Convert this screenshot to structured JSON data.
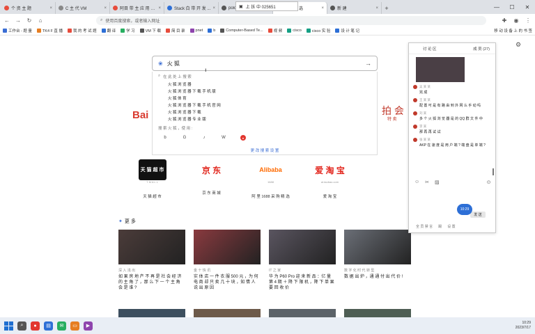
{
  "tabs": [
    {
      "label": "个 资 主 题",
      "color": "#e74c3c",
      "active": false
    },
    {
      "label": "C 主 代 VM",
      "color": "#888888",
      "active": false
    },
    {
      "label": "阿目 带 主 应 用 app 开 户 ...",
      "color": "#e74c3c",
      "active": false
    },
    {
      "label": "Stack 白 带 开 发 ...",
      "color": "#2d6fd6",
      "active": false
    },
    {
      "label": "pology",
      "color": "#555555",
      "active": false
    },
    {
      "label": "带 拍 选 选",
      "color": "#e74c3c",
      "active": true
    },
    {
      "label": "新 建",
      "color": "#555555",
      "active": false
    }
  ],
  "share_banner": "上 拆 中 025651",
  "omnibox": {
    "placeholder": "使用百度搜索，或者输入网址"
  },
  "bookmarks": [
    {
      "label": "工作台 - 题 量",
      "color": "#3b6ed4"
    },
    {
      "label": "TK4 F 直 播",
      "color": "#e67e22"
    },
    {
      "label": "我 的 考 试 题",
      "color": "#e74c3c"
    },
    {
      "label": "翻 译",
      "color": "#2d6fd6"
    },
    {
      "label": "学 习",
      "color": "#27ae60"
    },
    {
      "label": "VM 下 载",
      "color": "#555555"
    },
    {
      "label": "简 目 录",
      "color": "#e74c3c"
    },
    {
      "label": "pnet",
      "color": "#8e44ad"
    },
    {
      "label": "b",
      "color": "#2d6fd6"
    },
    {
      "label": "Computer-Based Te...",
      "color": "#555555"
    },
    {
      "label": "视 频",
      "color": "#e74c3c"
    },
    {
      "label": "cisco",
      "color": "#16a085"
    },
    {
      "label": "cisco 实 验",
      "color": "#16a085"
    },
    {
      "label": "设 计 笔 记",
      "color": "#2d6fd6"
    }
  ],
  "bookmarks_right": "移 动 设 备 上 的 书 签",
  "search": {
    "value": "火 狐",
    "caret": "I"
  },
  "suggest": {
    "head": "在 此 处 上 搜 索",
    "items": [
      "火 狐 浏 览 器",
      "火 狐 浏 览 器 下 载 手 机 版",
      "火 狐 体 育",
      "火 狐 浏 览 器 下 载 手 机 官 网",
      "火 狐 浏 览 器 下 载",
      "火 狐 浏 览 器 专 业 版"
    ],
    "search_with": "搜 索 火 狐 ，使 用 :",
    "engines": [
      "b",
      "G",
      "♪",
      "W",
      "●"
    ],
    "footer": "更 改 搜 索 设 置"
  },
  "side_logo_left": "Bai",
  "side_logo_right": "拍 会",
  "side_logo_right_sub": "特 卖",
  "shortcuts": [
    {
      "logo": "天 猫 超 市",
      "sub": "T M A L L",
      "label": "天 猫 超 市"
    },
    {
      "logo": "京 东",
      "sub": "",
      "label": "京 东 商 城"
    },
    {
      "logo": "Alibaba",
      "sub": "1688",
      "label": "阿 里 1688 采 购 精 选"
    },
    {
      "logo": "爱 淘 宝",
      "sub": "ai.taobao.com",
      "label": "爱 淘 宝"
    }
  ],
  "more_label": "更 多",
  "cards": [
    {
      "source": "深 入 浅 出",
      "title": "如 果 房 地 产 不 再 是 社 会 经 济 的 主 角 了 ，那 么 下 一 个 主 角 会 是 谁 ?",
      "color": "#4b3c3a"
    },
    {
      "source": "金 十 快 讯",
      "title": "实 体 店 一 件 衣 服 500 元 ，为 何 电 商 却 只 卖 几 十 块 ，知 情 人 说 出 原 因",
      "color": "#8a3a3f"
    },
    {
      "source": "IT 之 家",
      "title": "华 为 P60 Pro 迎 来 新 品 ：亿 量 第 4 期 ＋ 降 下 限 机 ，降 下 单 果 要 回 收 价",
      "color": "#5a5560"
    },
    {
      "source": "数 字 化 时 代 转 型",
      "title": "数 据 出 炉 ，通 通 付 出 代 价 !",
      "color": "#6b6f77"
    }
  ],
  "cards_row2": [
    "#3d4f5f",
    "#6d5a4a",
    "#5b6268",
    "#4e5e54"
  ],
  "chat": {
    "tab": "讨 论 区",
    "user": "成 员 (27)",
    "messages": [
      {
        "who": "吴 某 某",
        "text": "完 成"
      },
      {
        "who": "王 某 某",
        "text": "配 置 可 是 有 路 由 到 外 网 么 手 动 吗"
      },
      {
        "who": "刘 某",
        "text": "多 个 火 狐 浏 览 器 是 的 QQ 群 文 件 中"
      },
      {
        "who": "李 某",
        "text": "那 再 再 试 试"
      },
      {
        "who": "张 某 某",
        "text": "AKP 在 速 度 是 用 户 端 ? 端 盘 是 单 端 ?"
      }
    ],
    "send": "发 送",
    "bottom": [
      "全 员 禁 言",
      "踢",
      "设 置"
    ]
  },
  "timer": "10:29",
  "tray_time": "10:29",
  "tray_date": "2023/7/17"
}
